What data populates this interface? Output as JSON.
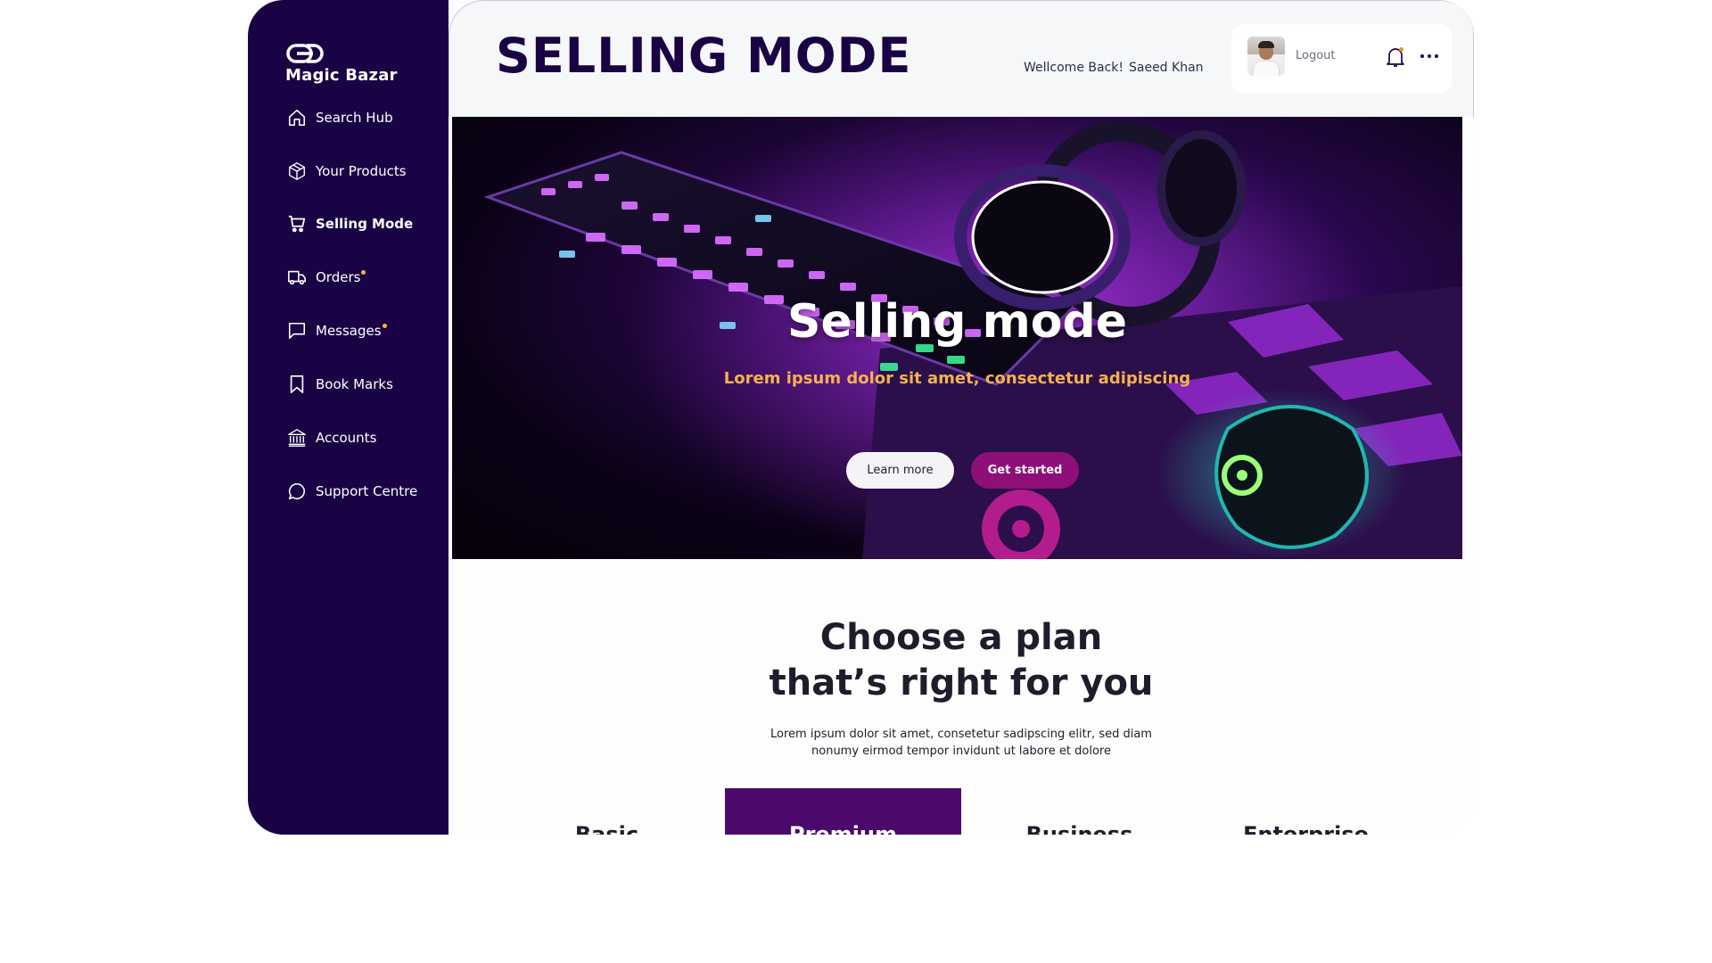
{
  "app": {
    "name": "Magic Bazar"
  },
  "sidebar": {
    "items": [
      {
        "label": "Search Hub",
        "icon": "home-icon"
      },
      {
        "label": "Your Products",
        "icon": "box-icon"
      },
      {
        "label": "Selling Mode",
        "icon": "cart-icon",
        "active": true
      },
      {
        "label": "Orders",
        "icon": "truck-icon",
        "badge": true
      },
      {
        "label": "Messages",
        "icon": "message-icon",
        "badge": true
      },
      {
        "label": "Book Marks",
        "icon": "bookmark-icon"
      },
      {
        "label": "Accounts",
        "icon": "bank-icon"
      },
      {
        "label": "Support Centre",
        "icon": "chat-icon"
      }
    ]
  },
  "header": {
    "title": "SELLING MODE",
    "welcome": "Wellcome Back!",
    "user_name": "Saeed Khan",
    "logout_label": "Logout"
  },
  "hero": {
    "title": "Selling mode",
    "subtitle": "Lorem ipsum dolor sit amet, consectetur adipiscing",
    "learn_more_label": "Learn more",
    "get_started_label": "Get started"
  },
  "plans": {
    "title_line1": "Choose a plan",
    "title_line2": "that’s right for you",
    "desc_line1": "Lorem ipsum dolor sit amet, consetetur sadipscing elitr, sed diam",
    "desc_line2": "nonumy eirmod tempor invidunt ut labore et dolore",
    "tabs": [
      "Basic",
      "Premium",
      "Business",
      "Enterprise"
    ],
    "featured": "Premium"
  },
  "colors": {
    "sidebar_bg": "#1a0344",
    "accent": "#8e0f77",
    "hero_subtitle": "#f5b24d",
    "badge": "#f7b43b",
    "featured_plan": "#4b0a6b"
  }
}
